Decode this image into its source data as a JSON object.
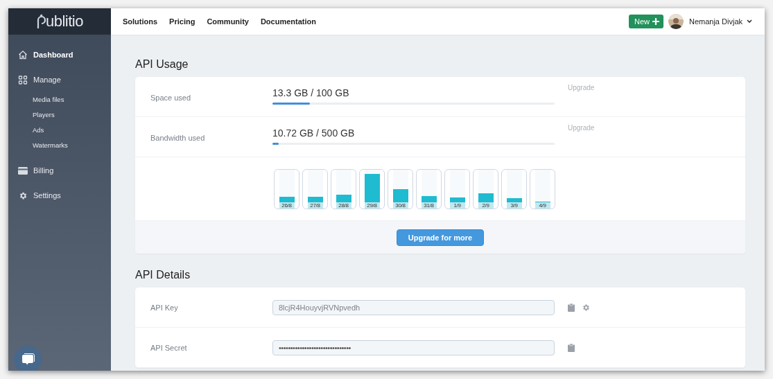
{
  "logo": {
    "text": "ublitio"
  },
  "nav": {
    "links": [
      {
        "label": "Solutions"
      },
      {
        "label": "Pricing"
      },
      {
        "label": "Community"
      },
      {
        "label": "Documentation"
      }
    ],
    "new_button": {
      "label": "New"
    },
    "user": {
      "name": "Nemanja Divjak"
    }
  },
  "sidebar": {
    "items": [
      {
        "label": "Dashboard",
        "selected": true
      },
      {
        "label": "Manage",
        "selected": false,
        "children": [
          {
            "label": "Media files",
            "selected": false
          },
          {
            "label": "Players",
            "selected": false
          },
          {
            "label": "Ads",
            "selected": false
          },
          {
            "label": "Watermarks",
            "selected": false
          }
        ]
      },
      {
        "label": "Billing",
        "selected": false
      },
      {
        "label": "Settings",
        "selected": false
      }
    ]
  },
  "api_usage": {
    "title": "API Usage",
    "rows": [
      {
        "label": "Space used",
        "value": "13.3 GB / 100 GB",
        "level": 0.133,
        "action": "Upgrade"
      },
      {
        "label": "Bandwidth used",
        "value": "10.72 GB / 500 GB",
        "level": 0.021,
        "action": "Upgrade"
      }
    ],
    "daily_bars": [
      {
        "label": "26/8",
        "level": 0.17
      },
      {
        "label": "27/8",
        "level": 0.15
      },
      {
        "label": "28/8",
        "level": 0.23
      },
      {
        "label": "29/8",
        "level": 0.87
      },
      {
        "label": "30/8",
        "level": 0.4
      },
      {
        "label": "31/8",
        "level": 0.19
      },
      {
        "label": "1/9",
        "level": 0.13
      },
      {
        "label": "2/9",
        "level": 0.26
      },
      {
        "label": "3/9",
        "level": 0.11
      },
      {
        "label": "4/9",
        "level": 0.02
      }
    ],
    "button": "Upgrade for more"
  },
  "api_details": {
    "title": "API Details",
    "rows": [
      {
        "kind": "key",
        "label": "API Key",
        "value": "8lcjR4HouyvjRVNpvedh"
      },
      {
        "kind": "secret",
        "label": "API Secret",
        "value": "•••••••••••••••••••••••••••••••"
      }
    ]
  }
}
